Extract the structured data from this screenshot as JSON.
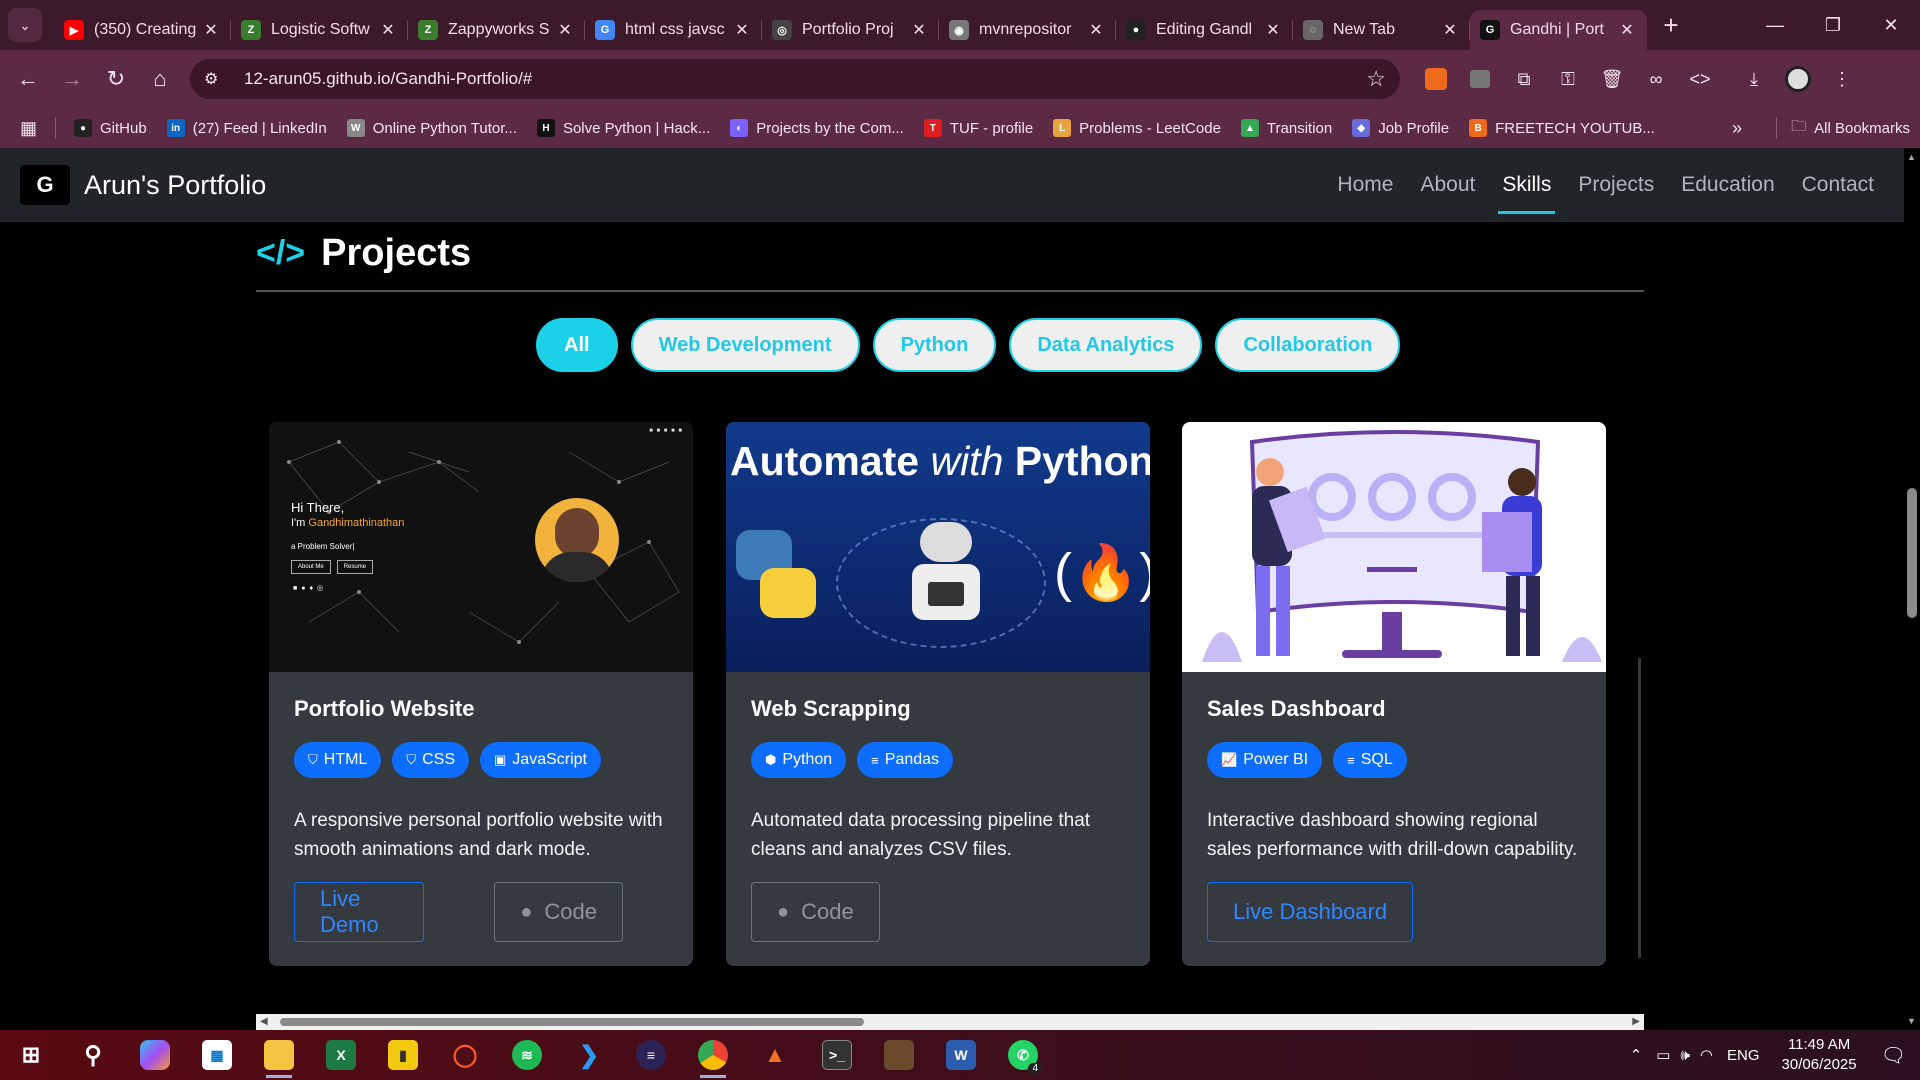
{
  "browser": {
    "tabs": [
      {
        "title": "(350) Creating",
        "color": "#ff0000",
        "glyph": "▶"
      },
      {
        "title": "Logistic Softw",
        "color": "#3a7d2c",
        "glyph": "Z"
      },
      {
        "title": "Zappyworks S",
        "color": "#3a7d2c",
        "glyph": "Z"
      },
      {
        "title": "html css javsc",
        "color": "#4285f4",
        "glyph": "G"
      },
      {
        "title": "Portfolio Proj",
        "color": "#444",
        "glyph": "◎"
      },
      {
        "title": "mvnrepositor",
        "color": "#777",
        "glyph": "◉"
      },
      {
        "title": "Editing Gandl",
        "color": "#222",
        "glyph": "●"
      },
      {
        "title": "New Tab",
        "color": "#666",
        "glyph": "◌"
      },
      {
        "title": "Gandhi | Port",
        "color": "#111",
        "glyph": "G",
        "active": true
      }
    ],
    "url": "12-arun05.github.io/Gandhi-Portfolio/#",
    "bookmarks": [
      {
        "label": "GitHub",
        "color": "#222",
        "glyph": "●"
      },
      {
        "label": "(27) Feed | LinkedIn",
        "color": "#0a66c2",
        "glyph": "in"
      },
      {
        "label": "Online Python Tutor...",
        "color": "#888",
        "glyph": "W"
      },
      {
        "label": "Solve Python | Hack...",
        "color": "#111",
        "glyph": "H"
      },
      {
        "label": "Projects by the Com...",
        "color": "#7b61ff",
        "glyph": "◐"
      },
      {
        "label": "TUF - profile",
        "color": "#e02020",
        "glyph": "T"
      },
      {
        "label": "Problems - LeetCode",
        "color": "#e8a33d",
        "glyph": "L"
      },
      {
        "label": "Transition",
        "color": "#34a853",
        "glyph": "▲"
      },
      {
        "label": "Job Profile",
        "color": "#6a6adb",
        "glyph": "◆"
      },
      {
        "label": "FREETECH YOUTUB...",
        "color": "#f06a1c",
        "glyph": "B"
      }
    ],
    "all_bookmarks": "All Bookmarks"
  },
  "site": {
    "brand": "Arun's Portfolio",
    "nav": [
      "Home",
      "About",
      "Skills",
      "Projects",
      "Education",
      "Contact"
    ],
    "active_nav": "Skills",
    "section_title": "Projects",
    "filters": [
      "All",
      "Web Development",
      "Python",
      "Data Analytics",
      "Collaboration"
    ],
    "active_filter": "All",
    "projects": [
      {
        "title": "Portfolio Website",
        "tags": [
          "HTML",
          "CSS",
          "JavaScript"
        ],
        "description": "A responsive personal portfolio website with smooth animations and dark mode.",
        "buttons": [
          {
            "label": "Live Demo",
            "style": "primary"
          },
          {
            "label": "Code",
            "style": "muted"
          }
        ],
        "preview": {
          "greeting": "Hi There,",
          "name_prefix": "I'm ",
          "name": "Gandhimathinathan",
          "role": "a Problem Solver|",
          "btn1": "About Me",
          "btn2": "Resume"
        }
      },
      {
        "title": "Web Scrapping",
        "tags": [
          "Python",
          "Pandas"
        ],
        "description": "Automated data processing pipeline that cleans and analyzes CSV files.",
        "buttons": [
          {
            "label": "Code",
            "style": "muted"
          }
        ],
        "preview": {
          "banner_a": "Automate ",
          "banner_b": "with",
          "banner_c": " Python"
        }
      },
      {
        "title": "Sales Dashboard",
        "tags": [
          "Power BI",
          "SQL"
        ],
        "description": "Interactive dashboard showing regional sales performance with drill-down capability.",
        "buttons": [
          {
            "label": "Live Dashboard",
            "style": "primary"
          }
        ]
      }
    ]
  },
  "taskbar": {
    "lang": "ENG",
    "time": "11:49 AM",
    "date": "30/06/2025",
    "whatsapp_badge": "4"
  }
}
